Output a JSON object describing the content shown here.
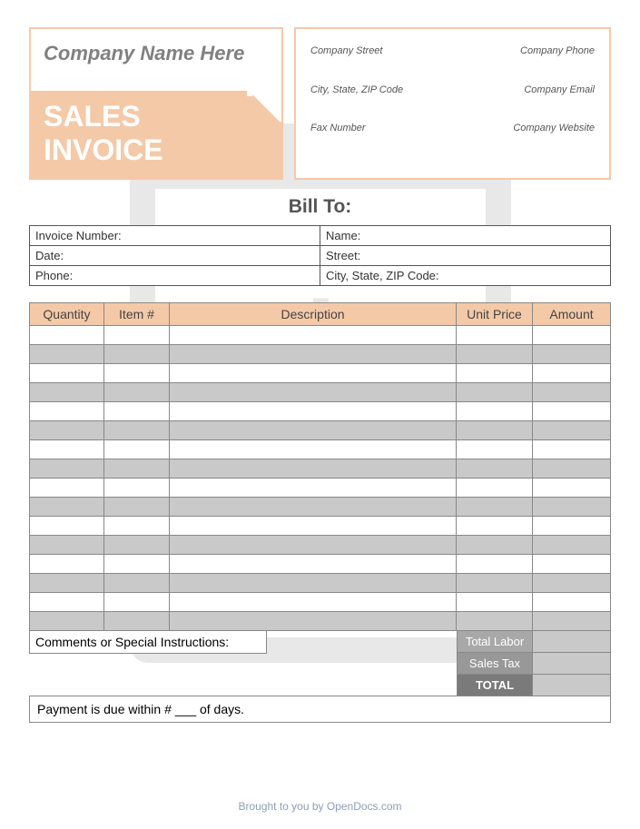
{
  "header": {
    "company_name": "Company Name Here",
    "title_line1": "SALES",
    "title_line2": "INVOICE"
  },
  "company_info": {
    "street": "Company Street",
    "phone": "Company Phone",
    "city": "City, State, ZIP Code",
    "email": "Company Email",
    "fax": "Fax Number",
    "website": "Company Website"
  },
  "bill_to": {
    "heading": "Bill To:",
    "rows": [
      {
        "left": "Invoice Number:",
        "right": "Name:"
      },
      {
        "left": "Date:",
        "right": "Street:"
      },
      {
        "left": "Phone:",
        "right": "City, State, ZIP Code:"
      }
    ]
  },
  "items_headers": {
    "quantity": "Quantity",
    "item": "Item #",
    "description": "Description",
    "unit_price": "Unit Price",
    "amount": "Amount"
  },
  "comments_label": "Comments or Special Instructions:",
  "totals": {
    "labor": "Total Labor",
    "tax": "Sales Tax",
    "total": "TOTAL"
  },
  "payment_terms": "Payment is due within # ___ of days.",
  "footer": "Brought to you by OpenDocs.com"
}
